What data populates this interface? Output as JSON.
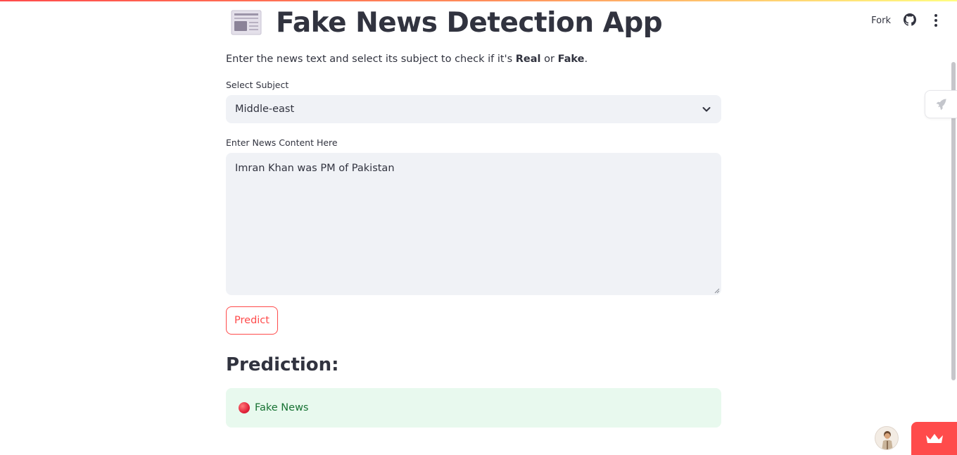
{
  "header": {
    "fork_label": "Fork",
    "icons": [
      "github-icon",
      "more-vertical-icon"
    ]
  },
  "app": {
    "title_icon": "newspaper-icon",
    "title": "Fake News Detection App",
    "intro": {
      "prefix": "Enter the news text and select its subject to check if it's ",
      "bold1": "Real",
      "middle": " or ",
      "bold2": "Fake",
      "suffix": "."
    }
  },
  "subject": {
    "label": "Select Subject",
    "selected": "Middle-east"
  },
  "content": {
    "label": "Enter News Content Here",
    "value": "Imran Khan was PM of Pakistan"
  },
  "predict": {
    "button_label": "Predict"
  },
  "prediction": {
    "heading": "Prediction:",
    "result_icon": "red-circle-icon",
    "result_text": "Fake News"
  },
  "colors": {
    "accent": "#ff4b4b",
    "input_bg": "#f0f2f6",
    "success_bg": "#e8f9ee",
    "success_text": "#177233"
  }
}
